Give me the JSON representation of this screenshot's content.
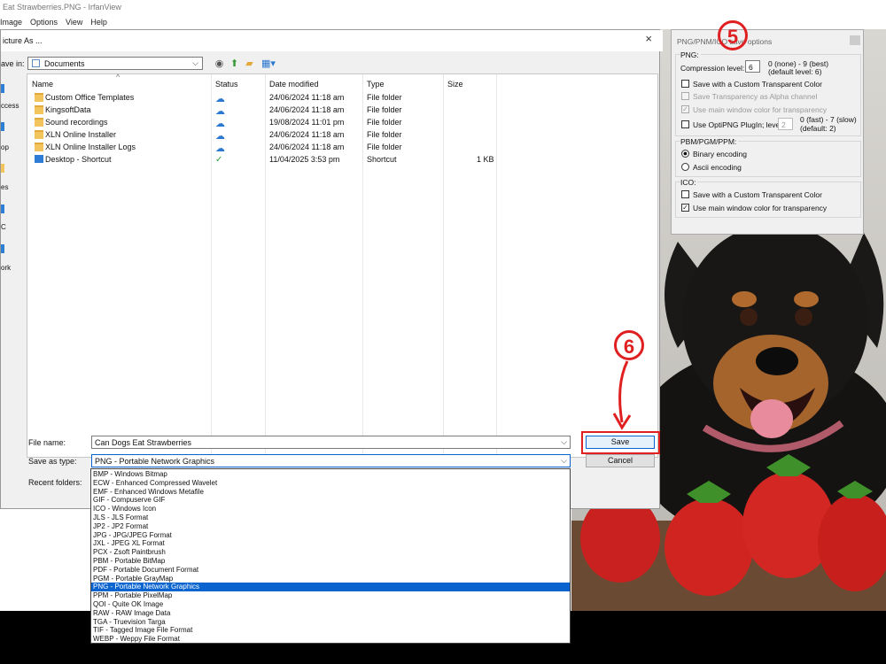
{
  "app": {
    "title": "Eat Strawberries.PNG - IrfanView",
    "menu": [
      "Image",
      "Options",
      "View",
      "Help"
    ]
  },
  "dialog": {
    "title": "icture As ...",
    "close": "×",
    "save_in_label": "ave in:",
    "save_in_value": "Documents",
    "places": [
      "ccess",
      "op",
      "es",
      "C",
      "ork"
    ],
    "columns": {
      "name": "Name",
      "status": "Status",
      "date": "Date modified",
      "type": "Type",
      "size": "Size"
    },
    "files": [
      {
        "name": "Custom Office Templates",
        "date": "24/06/2024 11:18 am",
        "type": "File folder",
        "size": "",
        "kind": "folder",
        "status": "cloud"
      },
      {
        "name": "KingsoftData",
        "date": "24/06/2024 11:18 am",
        "type": "File folder",
        "size": "",
        "kind": "folder",
        "status": "cloud"
      },
      {
        "name": "Sound recordings",
        "date": "19/08/2024 11:01 pm",
        "type": "File folder",
        "size": "",
        "kind": "folder",
        "status": "cloud"
      },
      {
        "name": "XLN Online Installer",
        "date": "24/06/2024 11:18 am",
        "type": "File folder",
        "size": "",
        "kind": "folder",
        "status": "cloud"
      },
      {
        "name": "XLN Online Installer Logs",
        "date": "24/06/2024 11:18 am",
        "type": "File folder",
        "size": "",
        "kind": "folder",
        "status": "cloud"
      },
      {
        "name": "Desktop - Shortcut",
        "date": "11/04/2025 3:53 pm",
        "type": "Shortcut",
        "size": "1 KB",
        "kind": "shortcut",
        "status": "synced"
      }
    ],
    "file_name_label": "File name:",
    "file_name_value": "Can Dogs Eat Strawberries",
    "save_as_type_label": "Save as type:",
    "save_as_type_value": "PNG - Portable Network Graphics",
    "recent_folders_label": "Recent folders:",
    "save_button": "Save",
    "cancel_button": "Cancel",
    "types": [
      "BMP - Windows Bitmap",
      "ECW - Enhanced Compressed Wavelet",
      "EMF - Enhanced Windows Metafile",
      "GIF - Compuserve GIF",
      "ICO - Windows Icon",
      "JLS - JLS Format",
      "JP2 - JP2 Format",
      "JPG - JPG/JPEG Format",
      "JXL - JPEG XL Format",
      "PCX - Zsoft Paintbrush",
      "PBM - Portable BitMap",
      "PDF - Portable Document Format",
      "PGM - Portable GrayMap",
      "PNG - Portable Network Graphics",
      "PPM - Portable PixelMap",
      "QOI - Quite OK Image",
      "RAW - RAW Image Data",
      "TGA - Truevision Targa",
      "TIF - Tagged Image File Format",
      "WEBP - Weppy File Format"
    ],
    "selected_type_index": 13
  },
  "png_options": {
    "title": "PNG/PNM/ICO save options",
    "png_group": "PNG:",
    "compression_label": "Compression level:",
    "compression_value": "6",
    "compression_hint": "0 (none) - 9 (best)",
    "compression_default": "(default level: 6)",
    "custom_transparent": "Save with a Custom Transparent Color",
    "alpha_channel": "Save Transparency as Alpha channel",
    "main_window_color": "Use main window color for transparency",
    "optipng_label": "Use OptiPNG PlugIn; level",
    "optipng_value": "2",
    "optipng_hint": "0 (fast) - 7 (slow)",
    "optipng_default": "(default: 2)",
    "pbm_group": "PBM/PGM/PPM:",
    "binary_encoding": "Binary encoding",
    "ascii_encoding": "Ascii encoding",
    "ico_group": "ICO:",
    "ico_custom_transparent": "Save with a Custom Transparent Color",
    "ico_main_window_color": "Use main window color for transparency"
  },
  "annotations": {
    "step5": "5",
    "step6": "6",
    "color": "#e02020"
  },
  "colors": {
    "selection": "#0a64d0",
    "folder": "#f2c55c",
    "cloud": "#2b78d0",
    "synced": "#2a9c3a"
  }
}
